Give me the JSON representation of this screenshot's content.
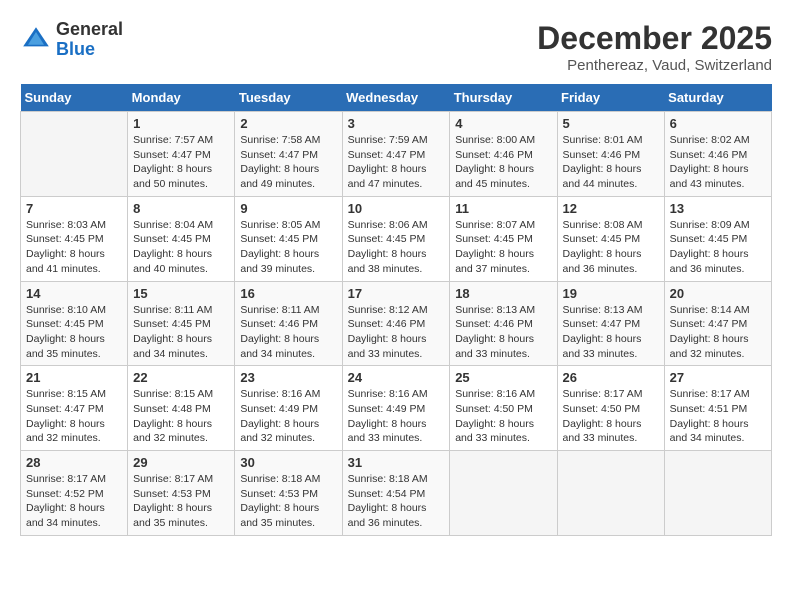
{
  "header": {
    "logo_general": "General",
    "logo_blue": "Blue",
    "title": "December 2025",
    "subtitle": "Penthereaz, Vaud, Switzerland"
  },
  "days_of_week": [
    "Sunday",
    "Monday",
    "Tuesday",
    "Wednesday",
    "Thursday",
    "Friday",
    "Saturday"
  ],
  "weeks": [
    [
      {
        "day": "",
        "sunrise": "",
        "sunset": "",
        "daylight": ""
      },
      {
        "day": "1",
        "sunrise": "Sunrise: 7:57 AM",
        "sunset": "Sunset: 4:47 PM",
        "daylight": "Daylight: 8 hours and 50 minutes."
      },
      {
        "day": "2",
        "sunrise": "Sunrise: 7:58 AM",
        "sunset": "Sunset: 4:47 PM",
        "daylight": "Daylight: 8 hours and 49 minutes."
      },
      {
        "day": "3",
        "sunrise": "Sunrise: 7:59 AM",
        "sunset": "Sunset: 4:47 PM",
        "daylight": "Daylight: 8 hours and 47 minutes."
      },
      {
        "day": "4",
        "sunrise": "Sunrise: 8:00 AM",
        "sunset": "Sunset: 4:46 PM",
        "daylight": "Daylight: 8 hours and 45 minutes."
      },
      {
        "day": "5",
        "sunrise": "Sunrise: 8:01 AM",
        "sunset": "Sunset: 4:46 PM",
        "daylight": "Daylight: 8 hours and 44 minutes."
      },
      {
        "day": "6",
        "sunrise": "Sunrise: 8:02 AM",
        "sunset": "Sunset: 4:46 PM",
        "daylight": "Daylight: 8 hours and 43 minutes."
      }
    ],
    [
      {
        "day": "7",
        "sunrise": "Sunrise: 8:03 AM",
        "sunset": "Sunset: 4:45 PM",
        "daylight": "Daylight: 8 hours and 41 minutes."
      },
      {
        "day": "8",
        "sunrise": "Sunrise: 8:04 AM",
        "sunset": "Sunset: 4:45 PM",
        "daylight": "Daylight: 8 hours and 40 minutes."
      },
      {
        "day": "9",
        "sunrise": "Sunrise: 8:05 AM",
        "sunset": "Sunset: 4:45 PM",
        "daylight": "Daylight: 8 hours and 39 minutes."
      },
      {
        "day": "10",
        "sunrise": "Sunrise: 8:06 AM",
        "sunset": "Sunset: 4:45 PM",
        "daylight": "Daylight: 8 hours and 38 minutes."
      },
      {
        "day": "11",
        "sunrise": "Sunrise: 8:07 AM",
        "sunset": "Sunset: 4:45 PM",
        "daylight": "Daylight: 8 hours and 37 minutes."
      },
      {
        "day": "12",
        "sunrise": "Sunrise: 8:08 AM",
        "sunset": "Sunset: 4:45 PM",
        "daylight": "Daylight: 8 hours and 36 minutes."
      },
      {
        "day": "13",
        "sunrise": "Sunrise: 8:09 AM",
        "sunset": "Sunset: 4:45 PM",
        "daylight": "Daylight: 8 hours and 36 minutes."
      }
    ],
    [
      {
        "day": "14",
        "sunrise": "Sunrise: 8:10 AM",
        "sunset": "Sunset: 4:45 PM",
        "daylight": "Daylight: 8 hours and 35 minutes."
      },
      {
        "day": "15",
        "sunrise": "Sunrise: 8:11 AM",
        "sunset": "Sunset: 4:45 PM",
        "daylight": "Daylight: 8 hours and 34 minutes."
      },
      {
        "day": "16",
        "sunrise": "Sunrise: 8:11 AM",
        "sunset": "Sunset: 4:46 PM",
        "daylight": "Daylight: 8 hours and 34 minutes."
      },
      {
        "day": "17",
        "sunrise": "Sunrise: 8:12 AM",
        "sunset": "Sunset: 4:46 PM",
        "daylight": "Daylight: 8 hours and 33 minutes."
      },
      {
        "day": "18",
        "sunrise": "Sunrise: 8:13 AM",
        "sunset": "Sunset: 4:46 PM",
        "daylight": "Daylight: 8 hours and 33 minutes."
      },
      {
        "day": "19",
        "sunrise": "Sunrise: 8:13 AM",
        "sunset": "Sunset: 4:47 PM",
        "daylight": "Daylight: 8 hours and 33 minutes."
      },
      {
        "day": "20",
        "sunrise": "Sunrise: 8:14 AM",
        "sunset": "Sunset: 4:47 PM",
        "daylight": "Daylight: 8 hours and 32 minutes."
      }
    ],
    [
      {
        "day": "21",
        "sunrise": "Sunrise: 8:15 AM",
        "sunset": "Sunset: 4:47 PM",
        "daylight": "Daylight: 8 hours and 32 minutes."
      },
      {
        "day": "22",
        "sunrise": "Sunrise: 8:15 AM",
        "sunset": "Sunset: 4:48 PM",
        "daylight": "Daylight: 8 hours and 32 minutes."
      },
      {
        "day": "23",
        "sunrise": "Sunrise: 8:16 AM",
        "sunset": "Sunset: 4:49 PM",
        "daylight": "Daylight: 8 hours and 32 minutes."
      },
      {
        "day": "24",
        "sunrise": "Sunrise: 8:16 AM",
        "sunset": "Sunset: 4:49 PM",
        "daylight": "Daylight: 8 hours and 33 minutes."
      },
      {
        "day": "25",
        "sunrise": "Sunrise: 8:16 AM",
        "sunset": "Sunset: 4:50 PM",
        "daylight": "Daylight: 8 hours and 33 minutes."
      },
      {
        "day": "26",
        "sunrise": "Sunrise: 8:17 AM",
        "sunset": "Sunset: 4:50 PM",
        "daylight": "Daylight: 8 hours and 33 minutes."
      },
      {
        "day": "27",
        "sunrise": "Sunrise: 8:17 AM",
        "sunset": "Sunset: 4:51 PM",
        "daylight": "Daylight: 8 hours and 34 minutes."
      }
    ],
    [
      {
        "day": "28",
        "sunrise": "Sunrise: 8:17 AM",
        "sunset": "Sunset: 4:52 PM",
        "daylight": "Daylight: 8 hours and 34 minutes."
      },
      {
        "day": "29",
        "sunrise": "Sunrise: 8:17 AM",
        "sunset": "Sunset: 4:53 PM",
        "daylight": "Daylight: 8 hours and 35 minutes."
      },
      {
        "day": "30",
        "sunrise": "Sunrise: 8:18 AM",
        "sunset": "Sunset: 4:53 PM",
        "daylight": "Daylight: 8 hours and 35 minutes."
      },
      {
        "day": "31",
        "sunrise": "Sunrise: 8:18 AM",
        "sunset": "Sunset: 4:54 PM",
        "daylight": "Daylight: 8 hours and 36 minutes."
      },
      {
        "day": "",
        "sunrise": "",
        "sunset": "",
        "daylight": ""
      },
      {
        "day": "",
        "sunrise": "",
        "sunset": "",
        "daylight": ""
      },
      {
        "day": "",
        "sunrise": "",
        "sunset": "",
        "daylight": ""
      }
    ]
  ]
}
